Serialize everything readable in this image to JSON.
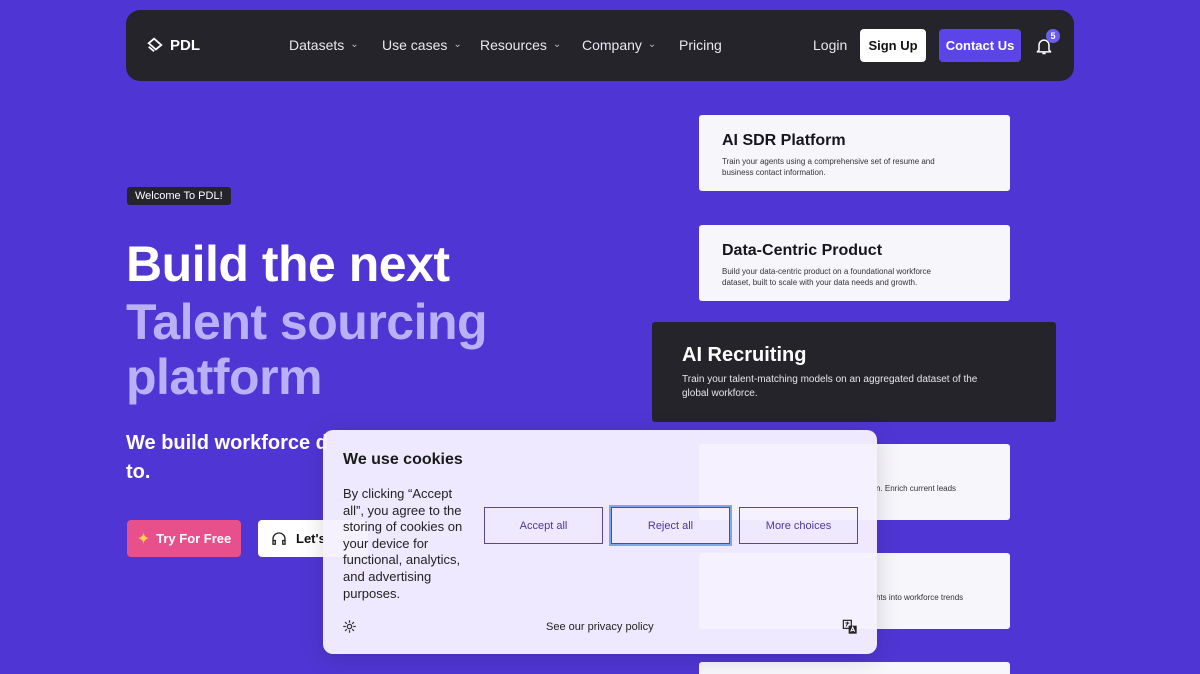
{
  "nav": {
    "logo_text": "PDL",
    "items": [
      {
        "label": "Datasets",
        "has_dropdown": true
      },
      {
        "label": "Use cases",
        "has_dropdown": true
      },
      {
        "label": "Resources",
        "has_dropdown": true
      },
      {
        "label": "Company",
        "has_dropdown": true
      },
      {
        "label": "Pricing",
        "has_dropdown": false
      }
    ],
    "login": "Login",
    "signup": "Sign Up",
    "contact": "Contact Us",
    "notifications": "5"
  },
  "hero": {
    "badge": "Welcome To PDL!",
    "line1": "Build the next",
    "line2": "Talent sourcing",
    "line3": "platform",
    "subline1": "We build workforce d",
    "subline2": "to.",
    "try_button": "Try For Free",
    "lets_button": "Let's"
  },
  "cards": [
    {
      "title": "AI SDR Platform",
      "text": "Train your agents using a comprehensive set of resume and business contact information."
    },
    {
      "title": "Data-Centric Product",
      "text": "Build your data-centric product on a foundational workforce dataset, built to scale with your data needs and growth."
    },
    {
      "title": "AI Recruiting",
      "text": "Train your talent-matching models on an aggregated dataset of the global workforce."
    },
    {
      "partial_text": "n. Enrich current leads"
    },
    {
      "partial_text": "hts into workforce trends"
    }
  ],
  "cookie": {
    "title": "We use cookies",
    "text": "By clicking “Accept all”, you agree to the storing of cookies on your device for functional, analytics, and advertising purposes.",
    "accept": "Accept all",
    "reject": "Reject all",
    "more": "More choices",
    "privacy": "See our privacy policy"
  },
  "colors": {
    "background": "#4f36d4",
    "nav_bg": "#25242b",
    "accent_purple": "#5b45e8",
    "pink": "#e8508c",
    "light_purple_text": "#b9b0f7"
  }
}
